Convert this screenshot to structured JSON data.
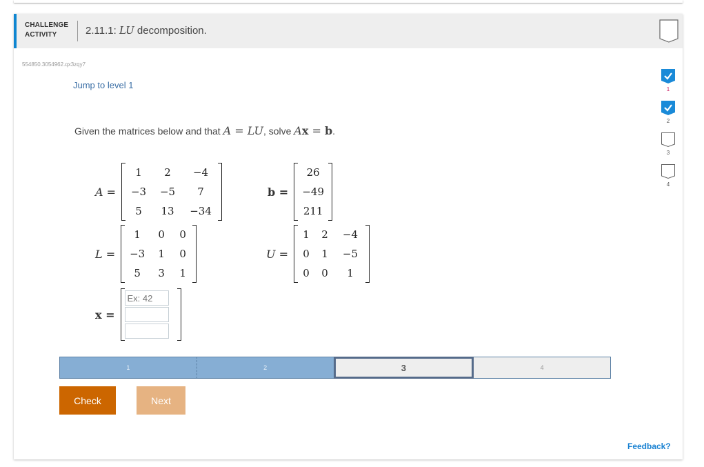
{
  "header": {
    "label_line1": "CHALLENGE",
    "label_line2": "ACTIVITY",
    "title_number": "2.11.1:",
    "title_math": "LU",
    "title_text": "decomposition."
  },
  "activity_id": "554850.3054962.qx3zqy7",
  "jump_link": "Jump to level 1",
  "prompt": {
    "text1": "Given the matrices below and that",
    "math1": "A = LU",
    "text2": ", solve",
    "math2_a": "A",
    "math2_x": "x",
    "math2_eq": " = ",
    "math2_b": "b",
    "text3": "."
  },
  "matrices": {
    "A": {
      "label": "A =",
      "rows": [
        [
          "1",
          "2",
          "−4"
        ],
        [
          "−3",
          "−5",
          "7"
        ],
        [
          "5",
          "13",
          "−34"
        ]
      ]
    },
    "b": {
      "label": "b =",
      "rows": [
        [
          "26"
        ],
        [
          "−49"
        ],
        [
          "211"
        ]
      ]
    },
    "L": {
      "label": "L =",
      "rows": [
        [
          "1",
          "0",
          "0"
        ],
        [
          "−3",
          "1",
          "0"
        ],
        [
          "5",
          "3",
          "1"
        ]
      ]
    },
    "U": {
      "label": "U =",
      "rows": [
        [
          "1",
          "2",
          "−4"
        ],
        [
          "0",
          "1",
          "−5"
        ],
        [
          "0",
          "0",
          "1"
        ]
      ]
    },
    "x": {
      "label": "x =",
      "inputs": [
        {
          "value": "",
          "placeholder": "Ex: 42"
        },
        {
          "value": "",
          "placeholder": ""
        },
        {
          "value": "",
          "placeholder": ""
        }
      ]
    }
  },
  "levels": [
    {
      "label": "1",
      "state": "done"
    },
    {
      "label": "2",
      "state": "done"
    },
    {
      "label": "3",
      "state": "current"
    },
    {
      "label": "4",
      "state": "todo"
    }
  ],
  "buttons": {
    "check": "Check",
    "next": "Next"
  },
  "progress": [
    {
      "label": "1",
      "completed": true
    },
    {
      "label": "2",
      "completed": true
    },
    {
      "label": "3",
      "completed": false
    },
    {
      "label": "4",
      "completed": false
    }
  ],
  "feedback": "Feedback?",
  "colors": {
    "accent": "#0f86d1",
    "check": "#cc6600",
    "next": "#e6b382",
    "level_done": "#86aed4"
  }
}
